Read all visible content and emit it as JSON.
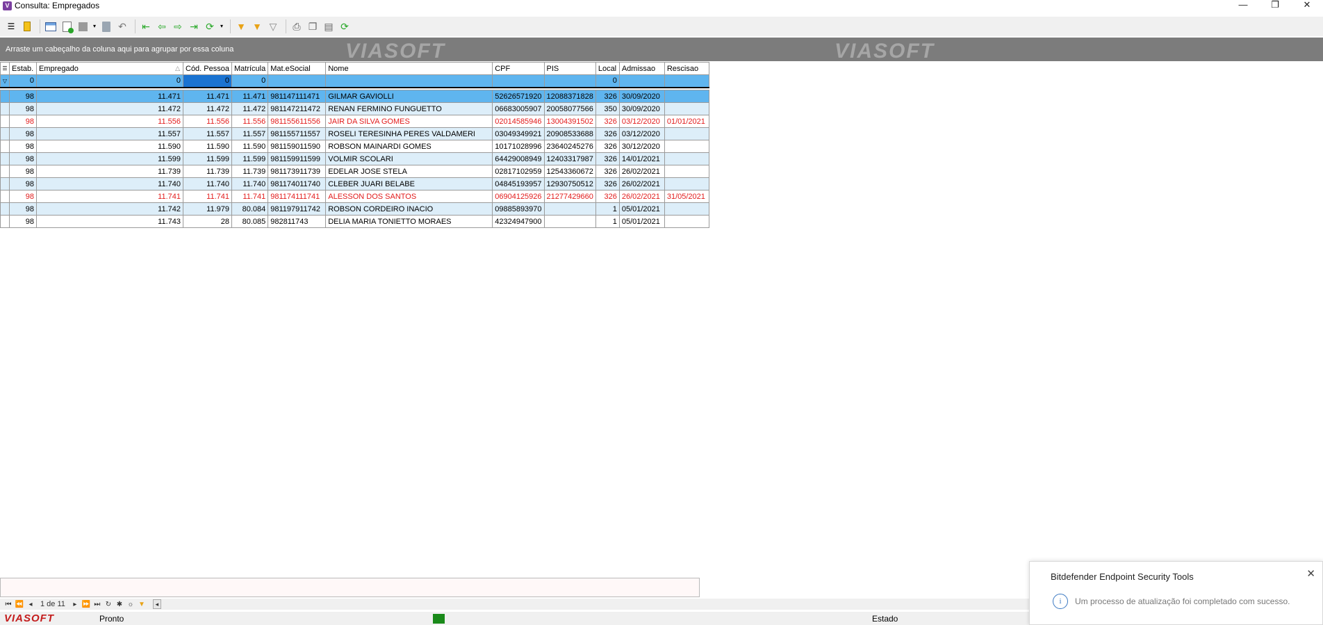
{
  "window": {
    "title": "Consulta: Empregados",
    "minimize": "—",
    "restore": "❐",
    "close": "✕"
  },
  "toolbar": {
    "icons": [
      "menu-icon",
      "bookmark-icon",
      "grid-icon",
      "new-icon",
      "stop-icon",
      "delete-icon",
      "undo-icon",
      "first-icon",
      "prev-icon",
      "next-icon",
      "last-icon",
      "refresh-icon",
      "filter-icon",
      "filter-a-icon",
      "filter-x-icon",
      "print-icon",
      "copy-icon",
      "paste-icon",
      "refresh-check-icon"
    ]
  },
  "group_panel": {
    "hint": "Arraste um cabeçalho da coluna aqui para agrupar por essa coluna",
    "watermark": "VIASOFT"
  },
  "grid": {
    "columns": [
      "Estab.",
      "Empregado",
      "Cód. Pessoa",
      "Matrícula",
      "Mat.eSocial",
      "Nome",
      "CPF",
      "PIS",
      "Local",
      "Admissao",
      "Rescisao"
    ],
    "sort_indicator": "△",
    "filter": [
      "0",
      "0",
      "0",
      "0",
      "",
      "",
      "",
      "",
      "0",
      "",
      ""
    ],
    "rows": [
      {
        "estab": "98",
        "empregado": "11.471",
        "cod": "11.471",
        "mat": "11.471",
        "esocial": "981147111471",
        "nome": "GILMAR GAVIOLLI",
        "cpf": "52626571920",
        "pis": "12088371828",
        "local": "326",
        "adm": "30/09/2020",
        "resc": "",
        "state": "selected"
      },
      {
        "estab": "98",
        "empregado": "11.472",
        "cod": "11.472",
        "mat": "11.472",
        "esocial": "981147211472",
        "nome": "RENAN FERMINO FUNGUETTO",
        "cpf": "06683005907",
        "pis": "20058077566",
        "local": "350",
        "adm": "30/09/2020",
        "resc": "",
        "state": "alt"
      },
      {
        "estab": "98",
        "empregado": "11.556",
        "cod": "11.556",
        "mat": "11.556",
        "esocial": "981155611556",
        "nome": "JAIR DA SILVA GOMES",
        "cpf": "02014585946",
        "pis": "13004391502",
        "local": "326",
        "adm": "03/12/2020",
        "resc": "01/01/2021",
        "state": "red"
      },
      {
        "estab": "98",
        "empregado": "11.557",
        "cod": "11.557",
        "mat": "11.557",
        "esocial": "981155711557",
        "nome": "ROSELI TERESINHA PERES VALDAMERI",
        "cpf": "03049349921",
        "pis": "20908533688",
        "local": "326",
        "adm": "03/12/2020",
        "resc": "",
        "state": "alt"
      },
      {
        "estab": "98",
        "empregado": "11.590",
        "cod": "11.590",
        "mat": "11.590",
        "esocial": "981159011590",
        "nome": "ROBSON MAINARDI GOMES",
        "cpf": "10171028996",
        "pis": "23640245276",
        "local": "326",
        "adm": "30/12/2020",
        "resc": "",
        "state": "normal"
      },
      {
        "estab": "98",
        "empregado": "11.599",
        "cod": "11.599",
        "mat": "11.599",
        "esocial": "981159911599",
        "nome": "VOLMIR SCOLARI",
        "cpf": "64429008949",
        "pis": "12403317987",
        "local": "326",
        "adm": "14/01/2021",
        "resc": "",
        "state": "alt"
      },
      {
        "estab": "98",
        "empregado": "11.739",
        "cod": "11.739",
        "mat": "11.739",
        "esocial": "981173911739",
        "nome": "EDELAR JOSE STELA",
        "cpf": "02817102959",
        "pis": "12543360672",
        "local": "326",
        "adm": "26/02/2021",
        "resc": "",
        "state": "normal"
      },
      {
        "estab": "98",
        "empregado": "11.740",
        "cod": "11.740",
        "mat": "11.740",
        "esocial": "981174011740",
        "nome": "CLEBER JUARI BELABE",
        "cpf": "04845193957",
        "pis": "12930750512",
        "local": "326",
        "adm": "26/02/2021",
        "resc": "",
        "state": "alt"
      },
      {
        "estab": "98",
        "empregado": "11.741",
        "cod": "11.741",
        "mat": "11.741",
        "esocial": "981174111741",
        "nome": "ALESSON DOS SANTOS",
        "cpf": "06904125926",
        "pis": "21277429660",
        "local": "326",
        "adm": "26/02/2021",
        "resc": "31/05/2021",
        "state": "red"
      },
      {
        "estab": "98",
        "empregado": "11.742",
        "cod": "11.979",
        "mat": "80.084",
        "esocial": "981197911742",
        "nome": "ROBSON CORDEIRO INACIO",
        "cpf": "09885893970",
        "pis": "",
        "local": "1",
        "adm": "05/01/2021",
        "resc": "",
        "state": "alt"
      },
      {
        "estab": "98",
        "empregado": "11.743",
        "cod": "28",
        "mat": "80.085",
        "esocial": "982811743",
        "nome": "DELIA MARIA TONIETTO MORAES",
        "cpf": "42324947900",
        "pis": "",
        "local": "1",
        "adm": "05/01/2021",
        "resc": "",
        "state": "normal"
      }
    ]
  },
  "navigator": {
    "page_info": "1 de 11"
  },
  "status": {
    "logo": "VIASOFT",
    "ready": "Pronto",
    "estado": "Estado"
  },
  "toast": {
    "title": "Bitdefender Endpoint Security Tools",
    "message": "Um processo de atualização foi completado com sucesso.",
    "info_glyph": "i",
    "close": "✕"
  },
  "colors": {
    "selected": "#5fb5ef",
    "alt": "#ddeef9",
    "red_text": "#e21b1b",
    "group_panel": "#7c7c7c"
  }
}
